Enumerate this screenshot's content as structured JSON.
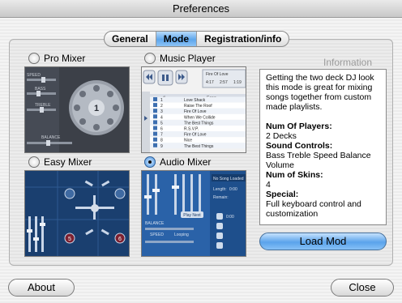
{
  "window": {
    "title": "Preferences"
  },
  "tabs": [
    {
      "label": "General",
      "active": false
    },
    {
      "label": "Mode",
      "active": true
    },
    {
      "label": "Registration/info",
      "active": false
    }
  ],
  "modes": [
    {
      "label": "Pro Mixer",
      "selected": false
    },
    {
      "label": "Music Player",
      "selected": false
    },
    {
      "label": "Easy Mixer",
      "selected": false
    },
    {
      "label": "Audio Mixer",
      "selected": true
    }
  ],
  "pro_mixer_preview": {
    "labels": [
      "SPEED",
      "BASS",
      "TREBLE",
      "BALANCE"
    ],
    "deck_number": "1"
  },
  "music_player_preview": {
    "now_playing": "Fire Of Love",
    "times": [
      "4:17",
      "2:57",
      "1:19"
    ],
    "columns": [
      "#",
      "Song"
    ],
    "rows": [
      {
        "num": "1",
        "song": "Love Shack"
      },
      {
        "num": "2",
        "song": "Raise The Roof"
      },
      {
        "num": "3",
        "song": "Fire Of Love"
      },
      {
        "num": "4",
        "song": "When We Collide"
      },
      {
        "num": "5",
        "song": "The Best Things"
      },
      {
        "num": "6",
        "song": "R.S.V.P."
      },
      {
        "num": "7",
        "song": "Fire Of Love"
      },
      {
        "num": "8",
        "song": "Nice"
      },
      {
        "num": "9",
        "song": "The Best Things"
      }
    ]
  },
  "easy_mixer_preview": {
    "deck_numbers": [
      "5",
      "6"
    ]
  },
  "audio_mixer_preview": {
    "status": "No Song Loaded",
    "length_label": "Length:",
    "length_value": "0:00",
    "remain_label": "Remain:",
    "play_next": "Play Next",
    "balance": "BALANCE",
    "speed": "SPEED",
    "looping": "Looping",
    "small_value": "0:00"
  },
  "information": {
    "heading": "Information",
    "description": "Getting the two deck DJ look this mode is great for mixing songs together from custom made playlists.",
    "fields": [
      {
        "label": "Num Of Players:",
        "value": "2 Decks"
      },
      {
        "label": "Sound Controls:",
        "value": "Bass  Treble  Speed Balance  Volume"
      },
      {
        "label": "Num of Skins:",
        "value": "4"
      },
      {
        "label": "Special:",
        "value": "Full keyboard control and customization"
      }
    ]
  },
  "buttons": {
    "load": "Load Mod",
    "about": "About",
    "close": "Close"
  },
  "colors": {
    "accent": "#5aa3eb",
    "preview_blue": "#1a3f6f",
    "preview_gray": "#3c4048"
  }
}
